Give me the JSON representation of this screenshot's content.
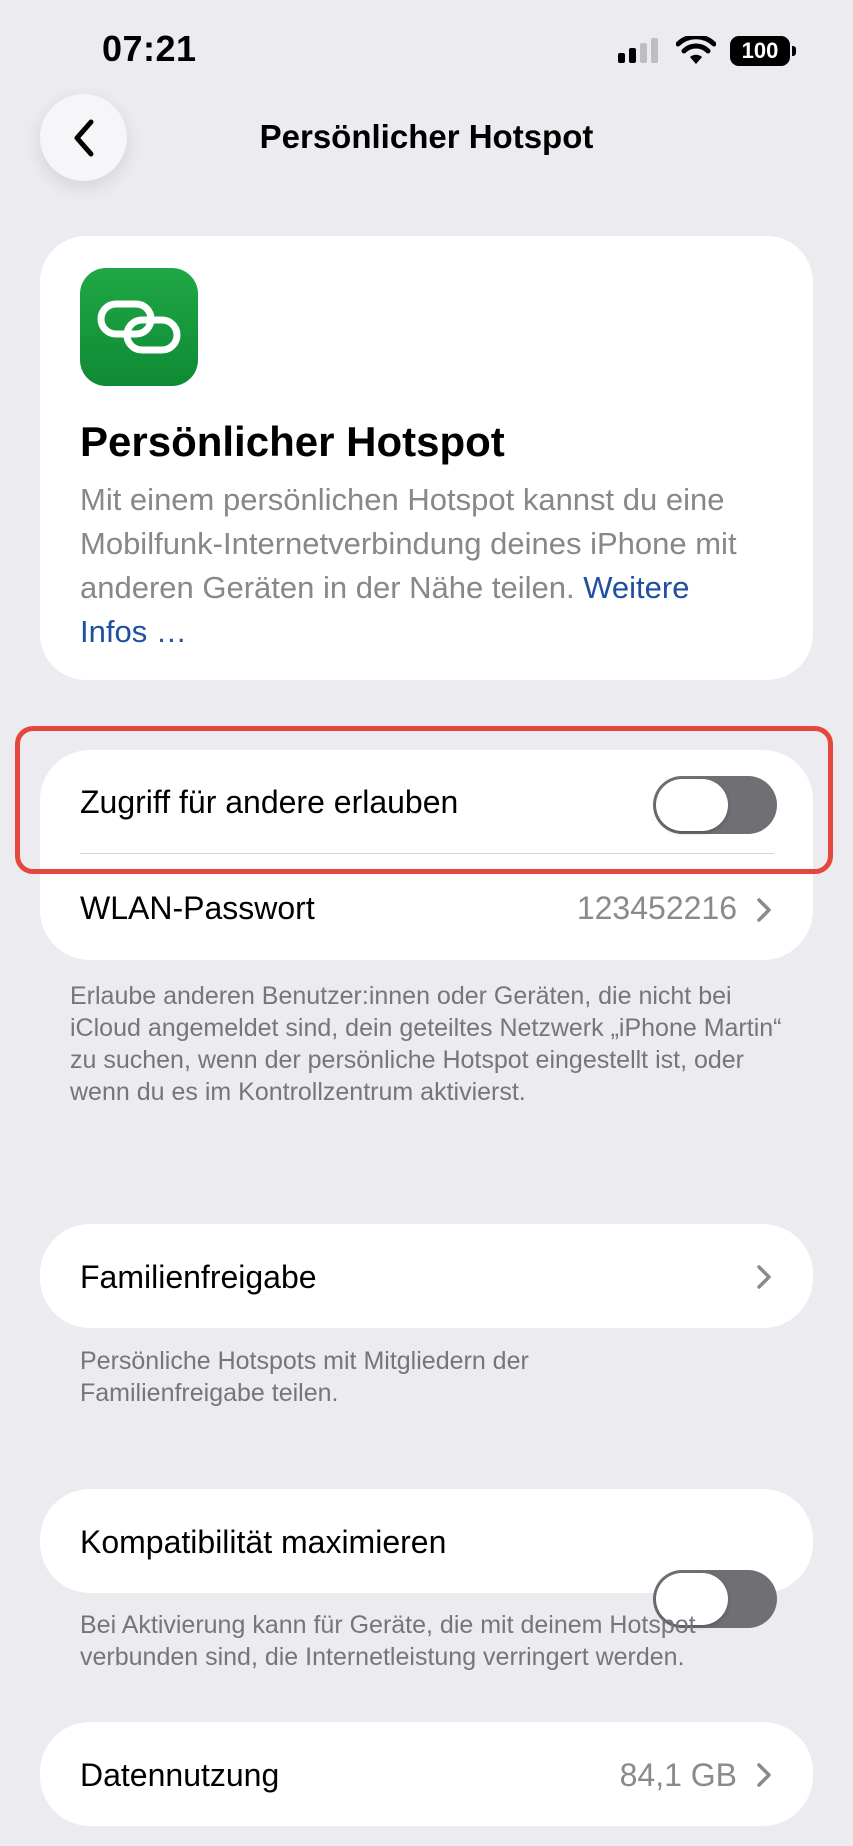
{
  "status_bar": {
    "time": "07:21",
    "battery": "100"
  },
  "nav": {
    "title": "Persönlicher Hotspot"
  },
  "hero": {
    "title": "Persönlicher Hotspot",
    "description": "Mit einem persönlichen Hotspot kannst du eine Mobilfunk-Internetverbindung deines iPhone mit anderen Geräten in der Nähe teilen.",
    "link": "Weitere Infos …"
  },
  "access": {
    "toggle_label": "Zugriff für andere erlauben",
    "toggle_on": false,
    "password_label": "WLAN-Passwort",
    "password_value": "123452216",
    "note": "Erlaube anderen Benutzer:innen oder Geräten, die nicht bei iCloud angemeldet sind, dein geteiltes Netzwerk „iPhone Martin“ zu suchen, wenn der persönliche Hotspot eingestellt ist, oder wenn du es im Kontrollzentrum aktivierst."
  },
  "family": {
    "label": "Familienfreigabe",
    "note": "Persönliche Hotspots mit Mitgliedern der Familienfreigabe teilen."
  },
  "compat": {
    "label": "Kompatibilität maximieren",
    "toggle_on": false,
    "note": "Bei Aktivierung kann für Geräte, die mit deinem Hotspot verbunden sind, die Internetleistung verringert werden."
  },
  "data_usage": {
    "label": "Datennutzung",
    "value": "84,1 GB"
  },
  "colors": {
    "accent": "#1f4fa0",
    "highlight": "#e5463d",
    "app_icon": "#1a9c40"
  }
}
